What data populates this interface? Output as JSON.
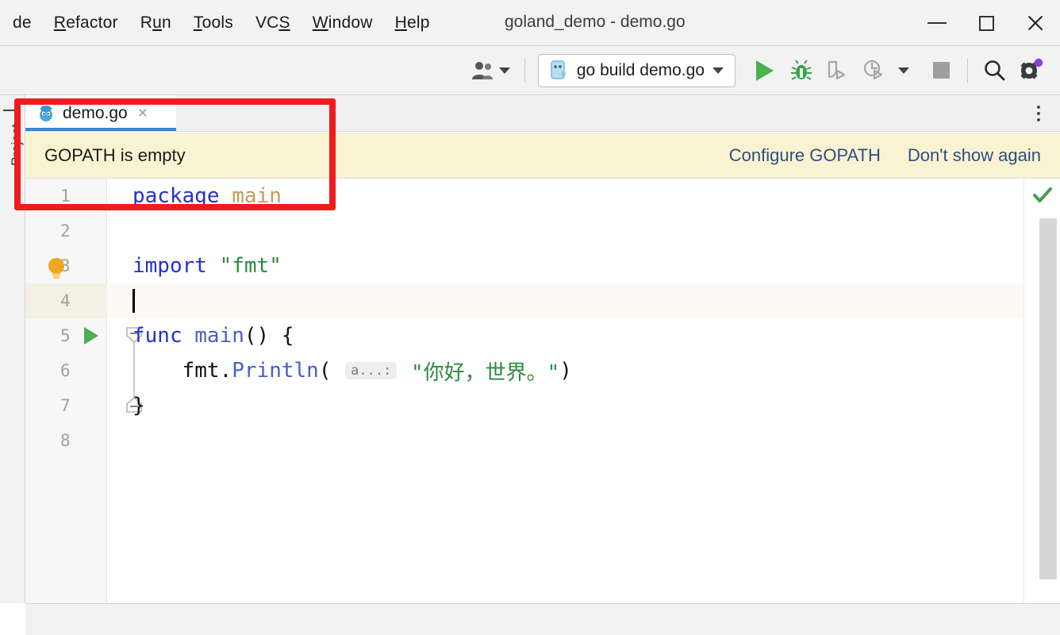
{
  "window": {
    "title": "goland_demo - demo.go",
    "controls": {
      "minimize": "minimize-button",
      "maximize": "maximize-button",
      "close": "close-button"
    }
  },
  "menubar": {
    "items": [
      {
        "label": "de",
        "mnemonic": ""
      },
      {
        "label": "Refactor",
        "mnemonic": "R"
      },
      {
        "label": "Run",
        "mnemonic": "u"
      },
      {
        "label": "Tools",
        "mnemonic": "T"
      },
      {
        "label": "VCS",
        "mnemonic": "S"
      },
      {
        "label": "Window",
        "mnemonic": "W"
      },
      {
        "label": "Help",
        "mnemonic": "H"
      }
    ]
  },
  "toolbar": {
    "avatar_label": "user-avatar",
    "run_config": {
      "label": "go build demo.go",
      "icon": "go-file-icon",
      "dropdown": "chevron-down-icon"
    },
    "actions": [
      {
        "name": "run-button",
        "icon": "play-icon",
        "state": "enabled"
      },
      {
        "name": "debug-button",
        "icon": "bug-icon",
        "state": "enabled"
      },
      {
        "name": "coverage-button",
        "icon": "coverage-icon",
        "state": "disabled"
      },
      {
        "name": "profile-button",
        "icon": "profiler-icon",
        "state": "disabled"
      },
      {
        "name": "stop-button",
        "icon": "stop-icon",
        "state": "disabled"
      },
      {
        "name": "search-button",
        "icon": "search-icon",
        "state": "enabled"
      },
      {
        "name": "settings-button",
        "icon": "gear-icon",
        "state": "enabled",
        "badge_color": "#8b3fe0"
      }
    ]
  },
  "left_tool_strip": {
    "items": [
      {
        "label": "Project",
        "name": "tool-window-project"
      }
    ]
  },
  "tabs": {
    "items": [
      {
        "label": "demo.go",
        "icon": "go-gopher-icon",
        "active": true,
        "close": "×"
      }
    ],
    "overflow_menu": "kebab-menu-icon"
  },
  "notification": {
    "message": "GOPATH is empty",
    "actions": [
      {
        "label": "Configure GOPATH"
      },
      {
        "label": "Don't show again"
      }
    ],
    "background": "#faf3d2",
    "link_color": "#2d4f82"
  },
  "editor": {
    "current_line": 4,
    "inspection_status": "ok-check-icon",
    "lightbulb": "intention-bulb-icon",
    "run_gutter_line": 5,
    "line_numbers": [
      "1",
      "2",
      "3",
      "4",
      "5",
      "6",
      "7",
      "8"
    ],
    "lines": [
      {
        "n": "1",
        "tokens": [
          {
            "t": "package",
            "c": "kw"
          },
          {
            "t": " ",
            "c": "plain"
          },
          {
            "t": "main",
            "c": "pkg"
          }
        ]
      },
      {
        "n": "2",
        "tokens": []
      },
      {
        "n": "3",
        "tokens": [
          {
            "t": "import",
            "c": "kw"
          },
          {
            "t": " ",
            "c": "plain"
          },
          {
            "t": "\"fmt\"",
            "c": "str"
          }
        ]
      },
      {
        "n": "4",
        "tokens": []
      },
      {
        "n": "5",
        "tokens": [
          {
            "t": "func",
            "c": "kw"
          },
          {
            "t": " ",
            "c": "plain"
          },
          {
            "t": "main",
            "c": "fn"
          },
          {
            "t": "() {",
            "c": "plain"
          }
        ]
      },
      {
        "n": "6",
        "tokens": [
          {
            "t": "    fmt",
            "c": "plain"
          },
          {
            "t": ".",
            "c": "plain"
          },
          {
            "t": "Println",
            "c": "fn"
          },
          {
            "t": "( ",
            "c": "plain"
          },
          {
            "t": "a...:",
            "c": "inlay"
          },
          {
            "t": " ",
            "c": "plain"
          },
          {
            "t": "\"你好，世界。\"",
            "c": "str"
          },
          {
            "t": ")",
            "c": "plain"
          }
        ]
      },
      {
        "n": "7",
        "tokens": [
          {
            "t": "}",
            "c": "plain"
          }
        ]
      },
      {
        "n": "8",
        "tokens": []
      }
    ],
    "colors": {
      "keyword": "#2432c7",
      "package_name": "#c39a5a",
      "string": "#2a8a3e",
      "function": "#4a5ec4",
      "plain": "#111111",
      "line_number": "#a0a0a0",
      "current_line_bg": "#fcfaf2"
    }
  },
  "annotation": {
    "type": "highlight-rectangle",
    "color": "#ee1c1c"
  }
}
